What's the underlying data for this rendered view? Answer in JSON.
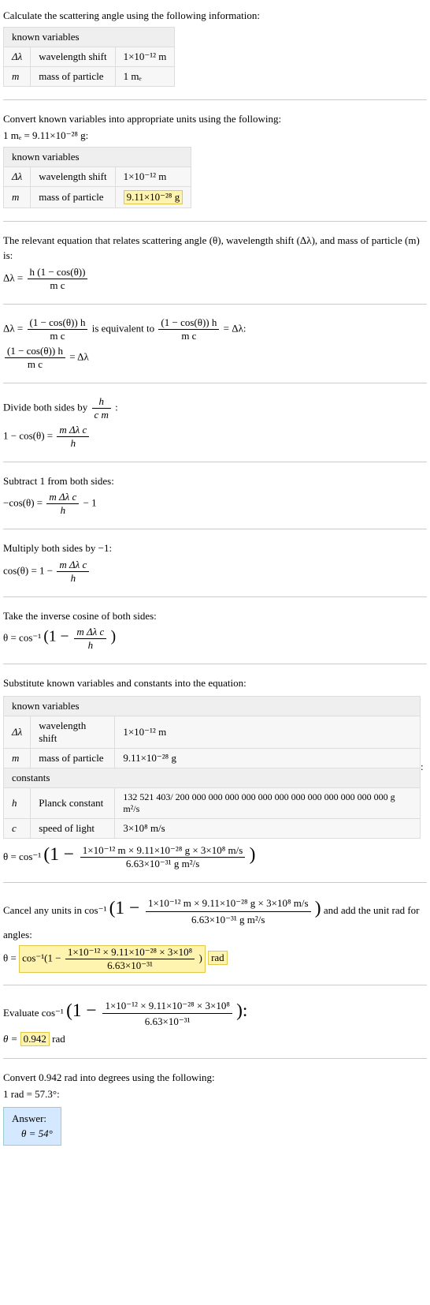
{
  "intro": "Calculate the scattering angle using the following information:",
  "table1": {
    "header": "known variables",
    "rows": [
      {
        "sym": "Δλ",
        "label": "wavelength shift",
        "val": "1×10⁻¹² m"
      },
      {
        "sym": "m",
        "label": "mass of particle",
        "val": "1 mₑ"
      }
    ]
  },
  "convert_heading": "Convert known variables into appropriate units using the following:",
  "convert_eq": "1 mₑ = 9.11×10⁻²⁸ g:",
  "table2": {
    "header": "known variables",
    "rows": [
      {
        "sym": "Δλ",
        "label": "wavelength shift",
        "val": "1×10⁻¹² m"
      },
      {
        "sym": "m",
        "label": "mass of particle",
        "val": "9.11×10⁻²⁸ g",
        "highlight": true
      }
    ]
  },
  "relevant_eq_text": "The relevant equation that relates scattering angle (θ), wavelength shift (Δλ), and mass of particle (m) is:",
  "eq1": {
    "lhs": "Δλ =",
    "num": "h (1 − cos(θ))",
    "den": "m c"
  },
  "equiv_part1": "Δλ =",
  "equiv_frac1_num": "(1 − cos(θ)) h",
  "equiv_frac1_den": "m c",
  "equiv_mid": " is equivalent to ",
  "equiv_frac2_num": "(1 − cos(θ)) h",
  "equiv_frac2_den": "m c",
  "equiv_end": " = Δλ:",
  "equiv_result_num": "(1 − cos(θ)) h",
  "equiv_result_den": "m c",
  "equiv_result_rhs": " = Δλ",
  "divide_text": "Divide both sides by ",
  "divide_frac_num": "h",
  "divide_frac_den": "c m",
  "divide_colon": " :",
  "divide_eq_lhs": "1 − cos(θ) = ",
  "divide_eq_num": "m Δλ c",
  "divide_eq_den": "h",
  "subtract_text": "Subtract 1 from both sides:",
  "subtract_eq_lhs": "−cos(θ) = ",
  "subtract_eq_num": "m Δλ c",
  "subtract_eq_den": "h",
  "subtract_eq_tail": " − 1",
  "multiply_text": "Multiply both sides by −1:",
  "multiply_eq_lhs": "cos(θ) = 1 − ",
  "multiply_eq_num": "m Δλ c",
  "multiply_eq_den": "h",
  "inverse_text": "Take the inverse cosine of both sides:",
  "inverse_eq_lhs": "θ = cos⁻¹",
  "inverse_eq_open": "(1 − ",
  "inverse_eq_num": "m Δλ c",
  "inverse_eq_den": "h",
  "inverse_eq_close": ")",
  "substitute_text": "Substitute known variables and constants into the equation:",
  "table3": {
    "header_known": "known variables",
    "rows_known": [
      {
        "sym": "Δλ",
        "label": "wavelength shift",
        "val": "1×10⁻¹² m"
      },
      {
        "sym": "m",
        "label": "mass of particle",
        "val": "9.11×10⁻²⁸ g"
      }
    ],
    "header_const": "constants",
    "rows_const": [
      {
        "sym": "h",
        "label": "Planck constant",
        "val": "132 521 403/ 200 000 000 000 000 000 000 000 000 000 000 000 000 g m²/s"
      },
      {
        "sym": "c",
        "label": "speed of light",
        "val": "3×10⁸ m/s"
      }
    ]
  },
  "table3_colon": ":",
  "sub_eq_lhs": "θ = cos⁻¹",
  "sub_eq_open": "(1 − ",
  "sub_eq_num": "1×10⁻¹² m × 9.11×10⁻²⁸ g × 3×10⁸ m/s",
  "sub_eq_den": "6.63×10⁻³¹ g m²/s",
  "sub_eq_close": ")",
  "cancel_text1": "Cancel any units in cos⁻¹",
  "cancel_open": "(1 − ",
  "cancel_num": "1×10⁻¹² m × 9.11×10⁻²⁸ g × 3×10⁸ m/s",
  "cancel_den": "6.63×10⁻³¹ g m²/s",
  "cancel_close": ")",
  "cancel_text2": " and add the unit rad for angles:",
  "cancel_eq_lhs": "θ = ",
  "cancel_eq_inner_pre": "cos⁻¹(1 − ",
  "cancel_eq_num": "1×10⁻¹² × 9.11×10⁻²⁸ × 3×10⁸",
  "cancel_eq_den": "6.63×10⁻³¹",
  "cancel_eq_inner_post": ")",
  "cancel_eq_rad": "rad",
  "eval_text": "Evaluate cos⁻¹",
  "eval_open": "(1 − ",
  "eval_num": "1×10⁻¹² × 9.11×10⁻²⁸ × 3×10⁸",
  "eval_den": "6.63×10⁻³¹",
  "eval_close": "):",
  "eval_eq_lhs": "θ = ",
  "eval_eq_val": "0.942",
  "eval_eq_unit": " rad",
  "convert_deg_text": "Convert 0.942 rad into degrees using the following:",
  "convert_deg_eq": "1 rad = 57.3°:",
  "answer_label": "Answer:",
  "answer_value": "θ = 54°"
}
